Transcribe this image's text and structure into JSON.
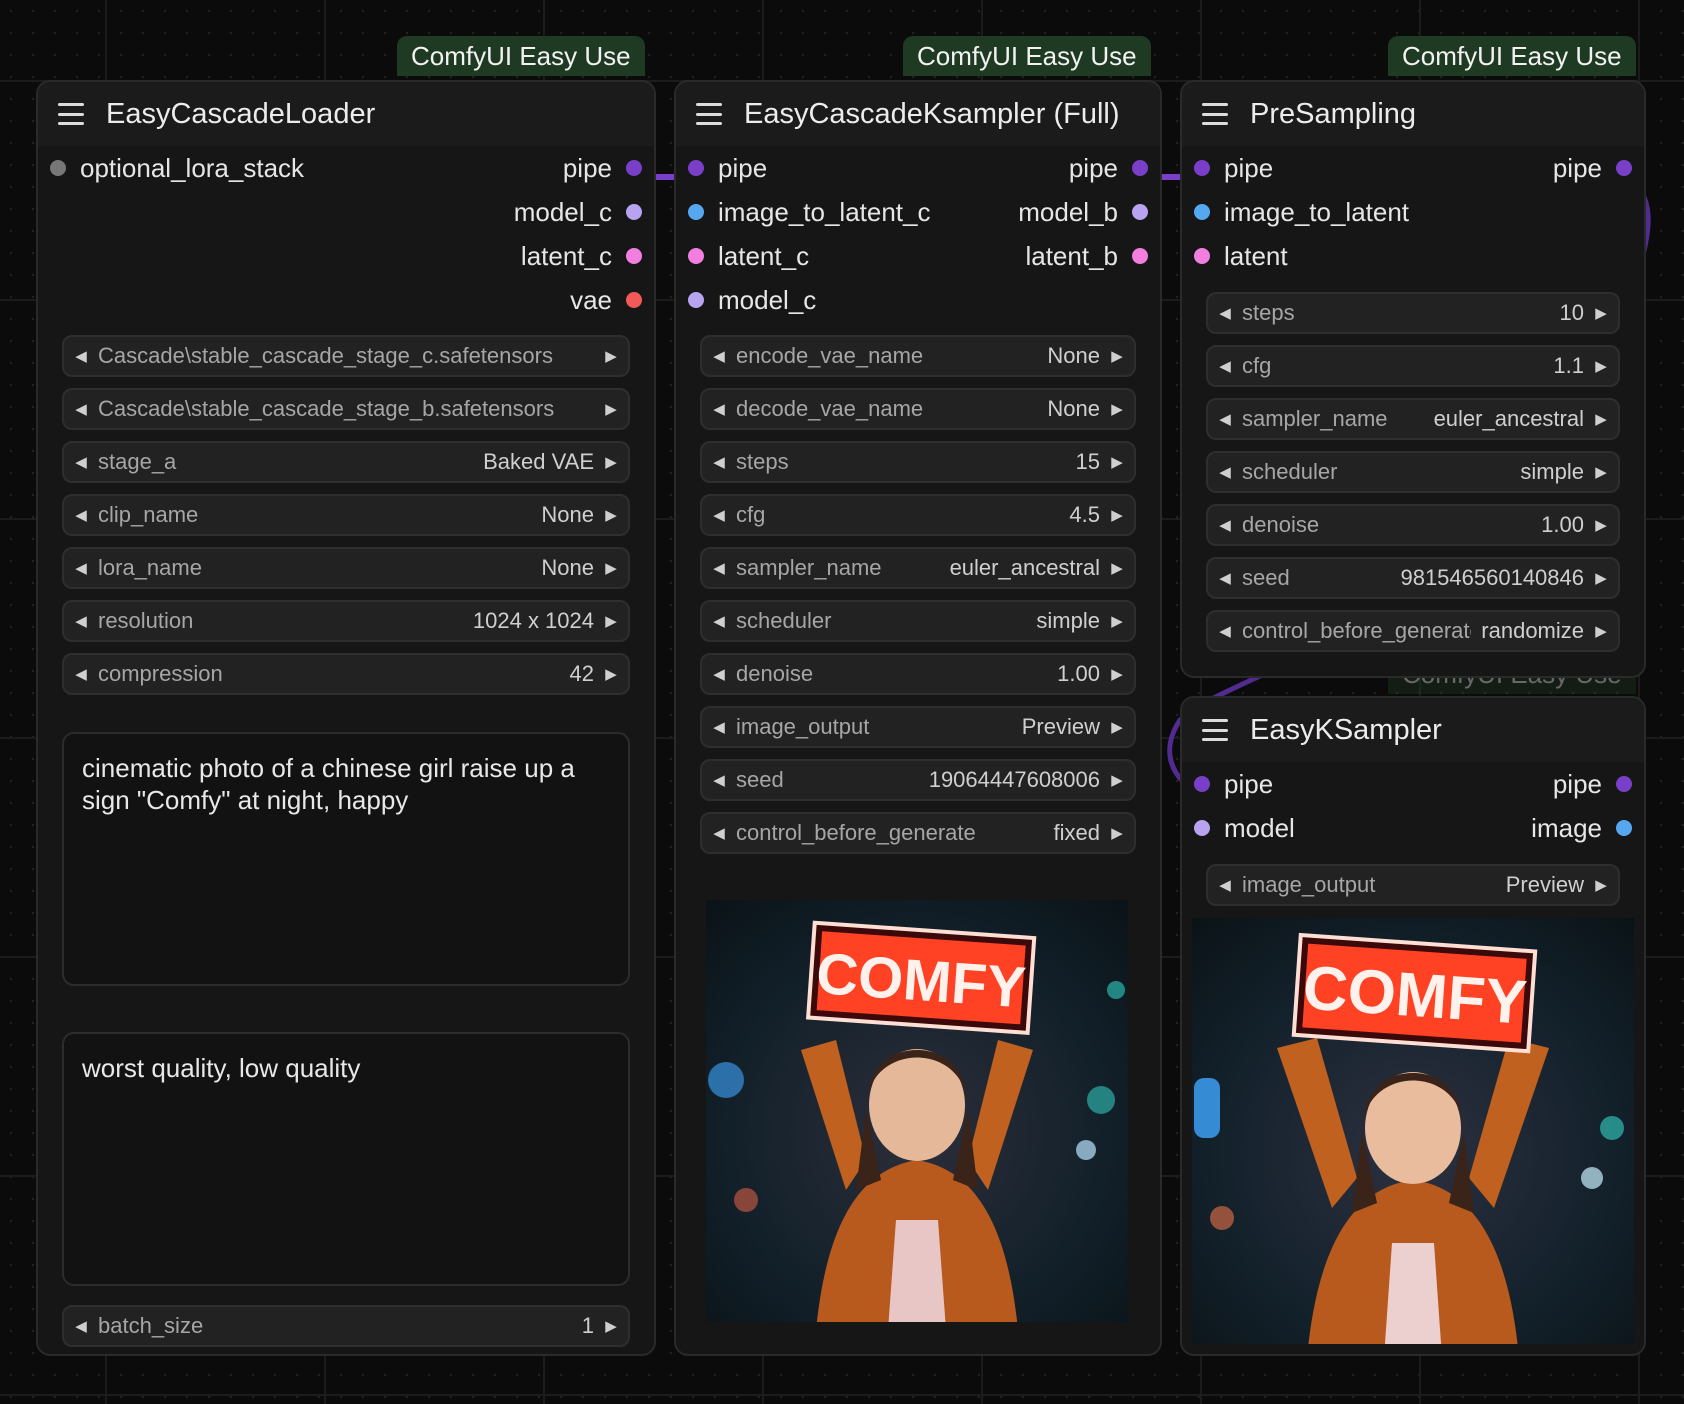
{
  "badge_text": "ComfyUI Easy Use",
  "colors": {
    "pipe": "#7a3fc8",
    "model": "#b7a3f0",
    "latent": "#f27fe0",
    "vae": "#f25a5a",
    "image": "#55a8f0",
    "optional": "#777777",
    "badge_bg": "#1f3a23"
  },
  "loader": {
    "title": "EasyCascadeLoader",
    "inputs": [
      {
        "label": "optional_lora_stack"
      }
    ],
    "outputs": [
      {
        "label": "pipe"
      },
      {
        "label": "model_c"
      },
      {
        "label": "latent_c"
      },
      {
        "label": "vae"
      }
    ],
    "widgets": [
      {
        "label": "stage_c",
        "value": "Cascade\\stable_cascade_stage_c.safetensors"
      },
      {
        "label": "stage_b",
        "value": "Cascade\\stable_cascade_stage_b.safetensors"
      },
      {
        "label": "stage_a",
        "value": "Baked VAE"
      },
      {
        "label": "clip_name",
        "value": "None"
      },
      {
        "label": "lora_name",
        "value": "None"
      },
      {
        "label": "resolution",
        "value": "1024 x 1024"
      },
      {
        "label": "compression",
        "value": "42"
      }
    ],
    "positive_prompt": "cinematic photo of a chinese girl raise up a sign \"Comfy\" at night, happy",
    "negative_prompt": "worst quality, low quality",
    "batch": {
      "label": "batch_size",
      "value": "1"
    }
  },
  "ksampler_full": {
    "title": "EasyCascadeKsampler (Full)",
    "inputs": [
      {
        "label": "pipe"
      },
      {
        "label": "image_to_latent_c"
      },
      {
        "label": "latent_c"
      },
      {
        "label": "model_c"
      }
    ],
    "outputs": [
      {
        "label": "pipe"
      },
      {
        "label": "model_b"
      },
      {
        "label": "latent_b"
      }
    ],
    "widgets": [
      {
        "label": "encode_vae_name",
        "value": "None"
      },
      {
        "label": "decode_vae_name",
        "value": "None"
      },
      {
        "label": "steps",
        "value": "15"
      },
      {
        "label": "cfg",
        "value": "4.5"
      },
      {
        "label": "sampler_name",
        "value": "euler_ancestral"
      },
      {
        "label": "scheduler",
        "value": "simple"
      },
      {
        "label": "denoise",
        "value": "1.00"
      },
      {
        "label": "image_output",
        "value": "Preview"
      },
      {
        "label": "seed",
        "value": "19064447608006"
      },
      {
        "label": "control_before_generate",
        "value": "fixed"
      }
    ],
    "preview_sign_text": "COMFY"
  },
  "presampling": {
    "title": "PreSampling",
    "inputs": [
      {
        "label": "pipe"
      },
      {
        "label": "image_to_latent"
      },
      {
        "label": "latent"
      }
    ],
    "outputs": [
      {
        "label": "pipe"
      }
    ],
    "widgets": [
      {
        "label": "steps",
        "value": "10"
      },
      {
        "label": "cfg",
        "value": "1.1"
      },
      {
        "label": "sampler_name",
        "value": "euler_ancestral"
      },
      {
        "label": "scheduler",
        "value": "simple"
      },
      {
        "label": "denoise",
        "value": "1.00"
      },
      {
        "label": "seed",
        "value": "981546560140846"
      },
      {
        "label": "control_before_generate",
        "value": "randomize"
      }
    ]
  },
  "ksampler": {
    "title": "EasyKSampler",
    "inputs": [
      {
        "label": "pipe"
      },
      {
        "label": "model"
      }
    ],
    "outputs": [
      {
        "label": "pipe"
      },
      {
        "label": "image"
      }
    ],
    "widgets": [
      {
        "label": "image_output",
        "value": "Preview"
      }
    ],
    "preview_sign_text": "COMFY"
  }
}
